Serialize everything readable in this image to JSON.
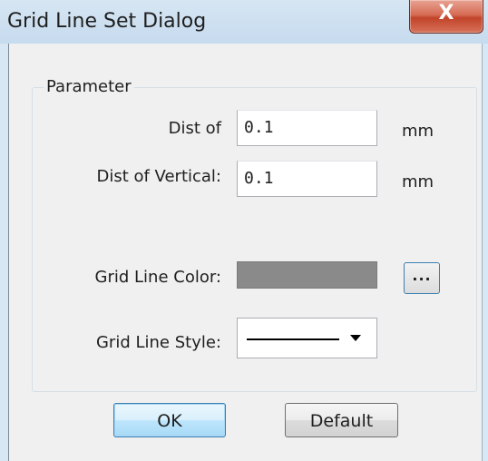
{
  "dialog": {
    "title": "Grid Line Set Dialog",
    "close_glyph": "X"
  },
  "parameter_group": {
    "label": "Parameter",
    "dist_label": "Dist of",
    "dist_value": "0.1",
    "dist_unit": "mm",
    "dist_vertical_label": "Dist of Vertical:",
    "dist_vertical_value": "0.1",
    "dist_vertical_unit": "mm",
    "grid_line_color_label": "Grid Line Color:",
    "grid_line_color": "#8a8a8a",
    "color_picker_button": "...",
    "grid_line_style_label": "Grid Line Style:",
    "grid_line_style_selected": "solid"
  },
  "buttons": {
    "ok": "OK",
    "default": "Default"
  },
  "colors": {
    "titlebar": "#c6dbee",
    "close_button": "#c1442a",
    "dialog_background": "#f0f0f0",
    "focus_border": "#3c7fb1"
  },
  "icons": {
    "close": "close-icon",
    "dropdown": "chevron-down-icon"
  }
}
